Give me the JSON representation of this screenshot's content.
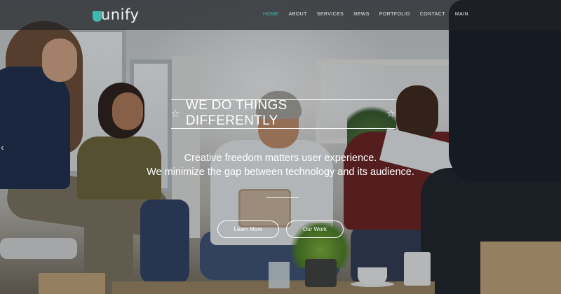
{
  "brand": {
    "logo_text": "unify",
    "accent_color": "#3fb8af"
  },
  "nav": {
    "items": [
      {
        "label": "HOME",
        "active": true
      },
      {
        "label": "ABOUT",
        "active": false
      },
      {
        "label": "SERVICES",
        "active": false
      },
      {
        "label": "NEWS",
        "active": false
      },
      {
        "label": "PORTFOLIO",
        "active": false
      },
      {
        "label": "CONTACT",
        "active": false
      },
      {
        "label": "MAIN",
        "active": false
      }
    ]
  },
  "hero": {
    "headline": "WE DO THINGS DIFFERENTLY",
    "subtitle_line1": "Creative freedom matters user experience.",
    "subtitle_line2": "We minimize the gap between technology and its audience.",
    "primary_button": "Learn More",
    "secondary_button": "Our Work",
    "slider_prev_icon": "chevron-left-icon",
    "headline_icons": [
      "star-outline-icon",
      "star-outline-icon"
    ]
  }
}
